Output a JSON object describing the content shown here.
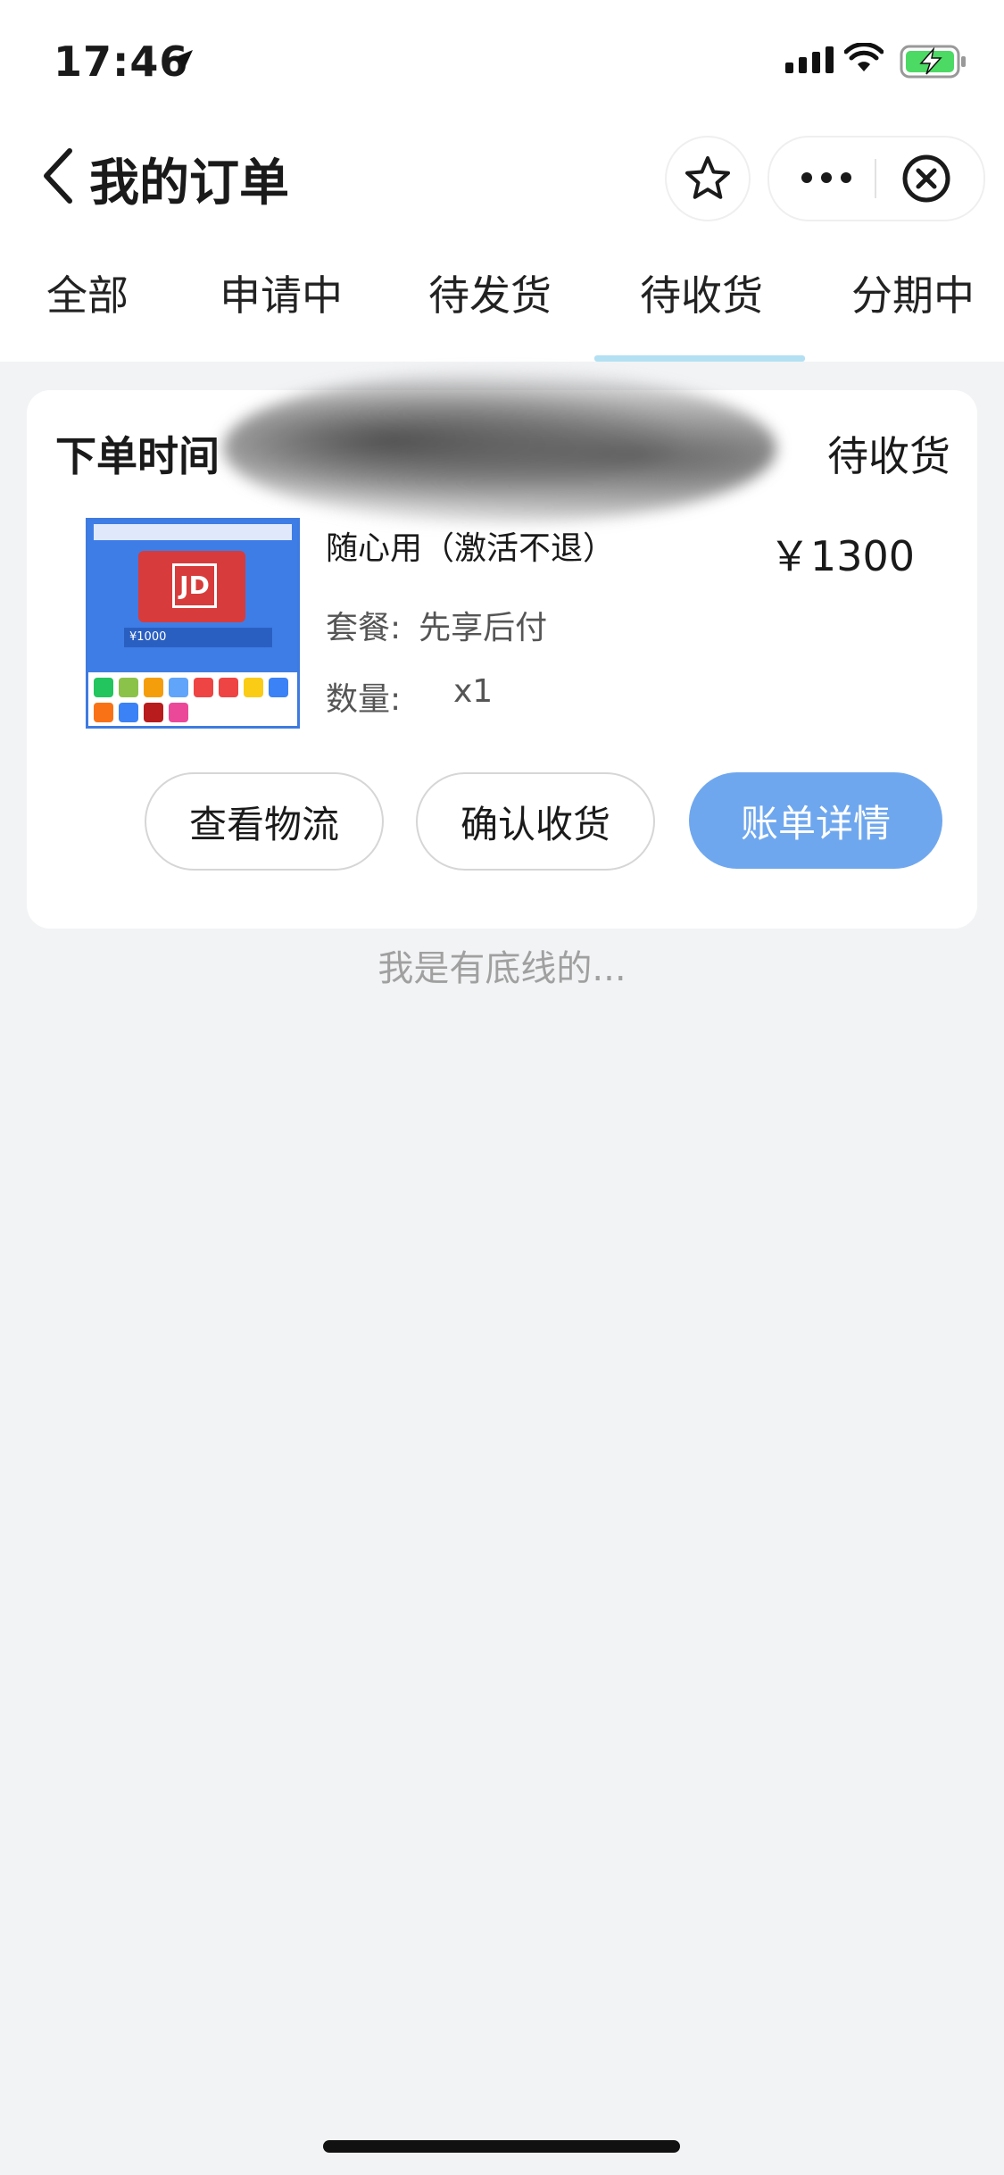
{
  "status_bar": {
    "time": "17:46"
  },
  "nav": {
    "title": "我的订单"
  },
  "tabs": [
    "全部",
    "申请中",
    "待发货",
    "待收货",
    "分期中"
  ],
  "active_tab_index": 3,
  "order": {
    "time_label": "下单时间",
    "status": "待收货",
    "product_name": "随心用（激活不退）",
    "price": "￥1300",
    "package_label": "套餐:",
    "package_value": "先享后付",
    "quantity_label": "数量:",
    "quantity_value": "x1",
    "image_price_text": "¥1000",
    "image_logo_text": "JD",
    "actions": {
      "logistics": "查看物流",
      "confirm": "确认收货",
      "bill": "账单详情"
    }
  },
  "footer": "我是有底线的...",
  "colors": {
    "primary_button": "#6fa7ee",
    "tab_indicator": "#b3e0f2",
    "background": "#f2f3f5",
    "battery_green": "#4cd964"
  }
}
